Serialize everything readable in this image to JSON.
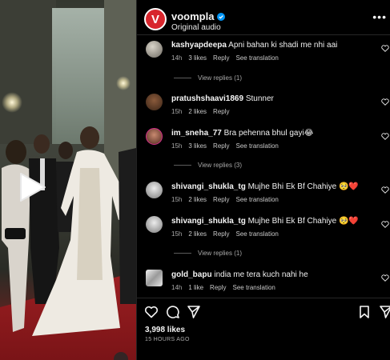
{
  "post": {
    "username": "voompla",
    "subtitle": "Original audio",
    "avatar_letter": "V",
    "more_label": "•••"
  },
  "comments": [
    {
      "user": "kashyapdeepa",
      "text": "Apni bahan ki shadi me nhi aai",
      "time": "14h",
      "likes": "3 likes",
      "reply": "Reply",
      "extra": "See translation",
      "replies": "View replies (1)"
    },
    {
      "user": "pratushshaavi1869",
      "text": "Stunner",
      "time": "15h",
      "likes": "2 likes",
      "reply": "Reply",
      "extra": "",
      "replies": ""
    },
    {
      "user": "im_sneha_77",
      "text": "Bra pehenna bhul gayi😂",
      "time": "15h",
      "likes": "3 likes",
      "reply": "Reply",
      "extra": "See translation",
      "replies": "View replies (3)"
    },
    {
      "user": "shivangi_shukla_tg",
      "text": "Mujhe Bhi Ek Bf Chahiye 🥺❤️",
      "time": "15h",
      "likes": "2 likes",
      "reply": "Reply",
      "extra": "See translation",
      "replies": ""
    },
    {
      "user": "shivangi_shukla_tg",
      "text": "Mujhe Bhi Ek Bf Chahiye 🥺❤️",
      "time": "15h",
      "likes": "2 likes",
      "reply": "Reply",
      "extra": "See translation",
      "replies": "View replies (1)"
    },
    {
      "user": "gold_bapu",
      "text": "india me tera kuch nahi he",
      "time": "14h",
      "likes": "1 like",
      "reply": "Reply",
      "extra": "See translation",
      "replies": ""
    }
  ],
  "footer": {
    "likes": "3,998 likes",
    "time": "15 HOURS AGO"
  },
  "colors": {
    "accent_red": "#d8262d",
    "verified_blue": "#0095f6",
    "muted": "#a8a8a8"
  },
  "icons": [
    "verified-badge-icon",
    "more-icon",
    "heart-icon",
    "comment-icon",
    "share-icon",
    "bookmark-icon",
    "play-icon"
  ]
}
